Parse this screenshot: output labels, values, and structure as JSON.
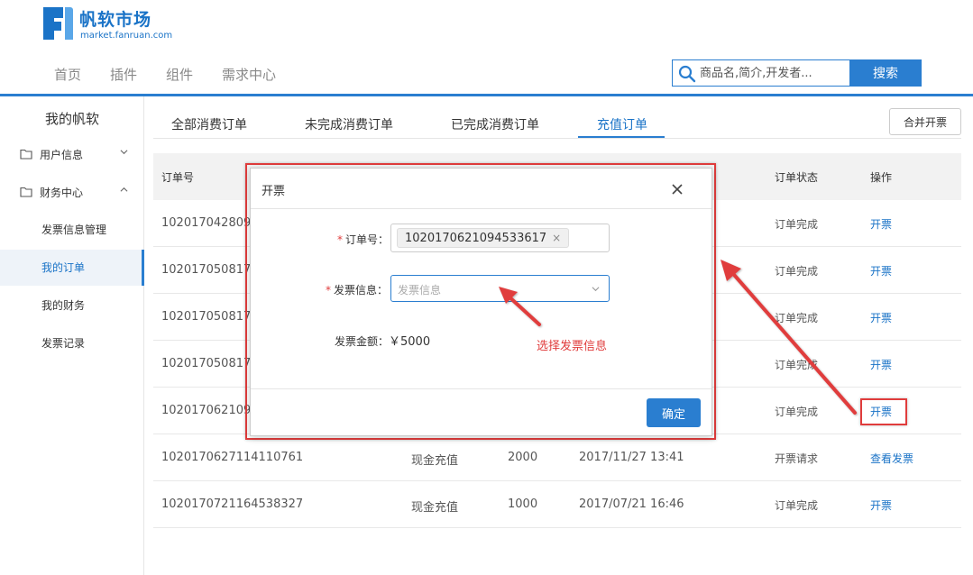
{
  "brand": {
    "name": "帆软市场",
    "url": "market.fanruan.com",
    "color": "#1a73c7"
  },
  "nav": {
    "items": [
      "首页",
      "插件",
      "组件",
      "需求中心"
    ]
  },
  "search": {
    "placeholder": "商品名,简介,开发者...",
    "button": "搜索"
  },
  "sidebar": {
    "title": "我的帆软",
    "groups": [
      {
        "label": "用户信息",
        "icon": "folder-icon",
        "state": "collapsed"
      },
      {
        "label": "财务中心",
        "icon": "folder-icon",
        "state": "expanded"
      }
    ],
    "items": [
      "发票信息管理",
      "我的订单",
      "我的财务",
      "发票记录"
    ],
    "active_item": "我的订单"
  },
  "tabs": {
    "items": [
      "全部消费订单",
      "未完成消费订单",
      "已完成消费订单",
      "充值订单"
    ],
    "active": "充值订单",
    "merge_button": "合并开票"
  },
  "table": {
    "headers": {
      "order_no": "订单号",
      "status": "订单状态",
      "action": "操作"
    },
    "rows": [
      {
        "order_no": "102017042809",
        "type": "",
        "amount": "",
        "time": "",
        "status": "订单完成",
        "action": "开票"
      },
      {
        "order_no": "102017050817",
        "type": "",
        "amount": "",
        "time": "",
        "status": "订单完成",
        "action": "开票"
      },
      {
        "order_no": "102017050817",
        "type": "",
        "amount": "",
        "time": "",
        "status": "订单完成",
        "action": "开票"
      },
      {
        "order_no": "102017050817",
        "type": "",
        "amount": "",
        "time": "",
        "status": "订单完成",
        "action": "开票"
      },
      {
        "order_no": "102017062109",
        "type": "",
        "amount": "",
        "time": "",
        "status": "订单完成",
        "action": "开票"
      },
      {
        "order_no": "1020170627114110761",
        "type": "现金充值",
        "amount": "2000",
        "time": "2017/11/27 13:41",
        "status": "开票请求",
        "action": "查看发票"
      },
      {
        "order_no": "1020170721164538327",
        "type": "现金充值",
        "amount": "1000",
        "time": "2017/07/21 16:46",
        "status": "订单完成",
        "action": "开票"
      }
    ]
  },
  "dialog": {
    "title": "开票",
    "order_label": "订单号：",
    "order_tag": "102017062109453361​7",
    "invoice_label": "发票信息：",
    "invoice_placeholder": "发票信息",
    "amount_label": "发票金额：",
    "amount_value": "￥5000",
    "confirm": "确定"
  },
  "annotation": {
    "text": "选择发票信息",
    "color": "#e03c3c"
  },
  "colors": {
    "accent": "#2a7ed0",
    "annotation": "#e03c3c",
    "active_bg": "#eef3f9"
  }
}
